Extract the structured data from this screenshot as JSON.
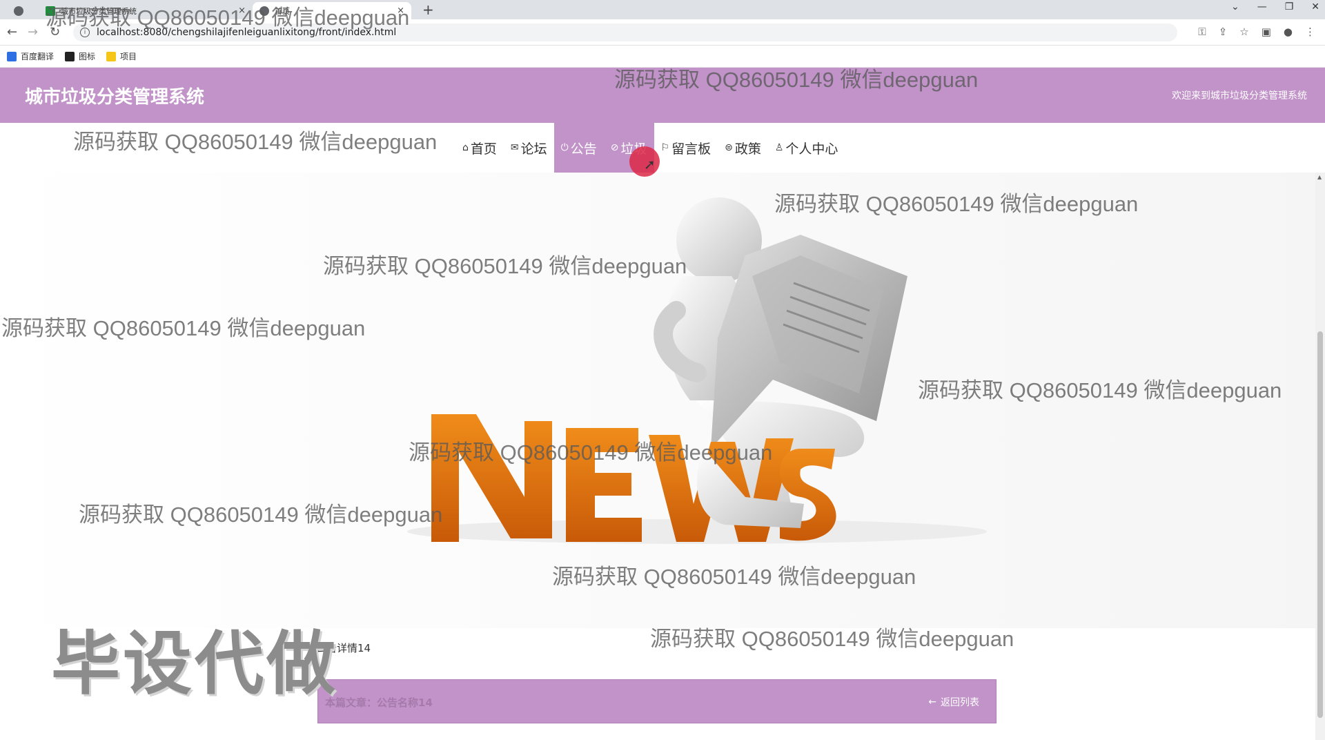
{
  "browser": {
    "tabs": [
      {
        "title": ""
      },
      {
        "title": "城市垃圾分类管理系统"
      },
      {
        "title": "首页"
      }
    ],
    "new_tab": "+",
    "tab_close": "×",
    "url": "localhost:8080/chengshilajifenleiguanlixitong/front/index.html",
    "window_controls": [
      "⌄",
      "—",
      "❐",
      "✕"
    ],
    "bookmarks": [
      {
        "label": "百度翻译",
        "color": "#2f6fe4"
      },
      {
        "label": "图标",
        "color": "#222222"
      },
      {
        "label": "项目",
        "color": "#f5c518"
      }
    ]
  },
  "site": {
    "title": "城市垃圾分类管理系统",
    "welcome": "欢迎来到城市垃圾分类管理系统",
    "accent_color": "#c193c9"
  },
  "nav": [
    {
      "icon": "⌂",
      "icon_name": "home-icon",
      "label": "首页",
      "active": false
    },
    {
      "icon": "✉",
      "icon_name": "forum-icon",
      "label": "论坛",
      "active": false
    },
    {
      "icon": "⏻",
      "icon_name": "notice-icon",
      "label": "公告",
      "active": true
    },
    {
      "icon": "⊘",
      "icon_name": "garbage-icon",
      "label": "垃圾",
      "active": true
    },
    {
      "icon": "⚐",
      "icon_name": "flag-icon",
      "label": "留言板",
      "active": false
    },
    {
      "icon": "⊜",
      "icon_name": "policy-icon",
      "label": "政策",
      "active": false
    },
    {
      "icon": "♙",
      "icon_name": "user-icon",
      "label": "个人中心",
      "active": false
    }
  ],
  "banner": {
    "headline": "NEWS"
  },
  "content": {
    "breadcrumb": "公告详情14",
    "article_label": "本篇文章：公告名称14",
    "back_label": "返回列表",
    "back_icon": "←"
  },
  "watermark": {
    "text": "源码获取 QQ86050149 微信deepguan",
    "stamp": "毕设代做"
  }
}
